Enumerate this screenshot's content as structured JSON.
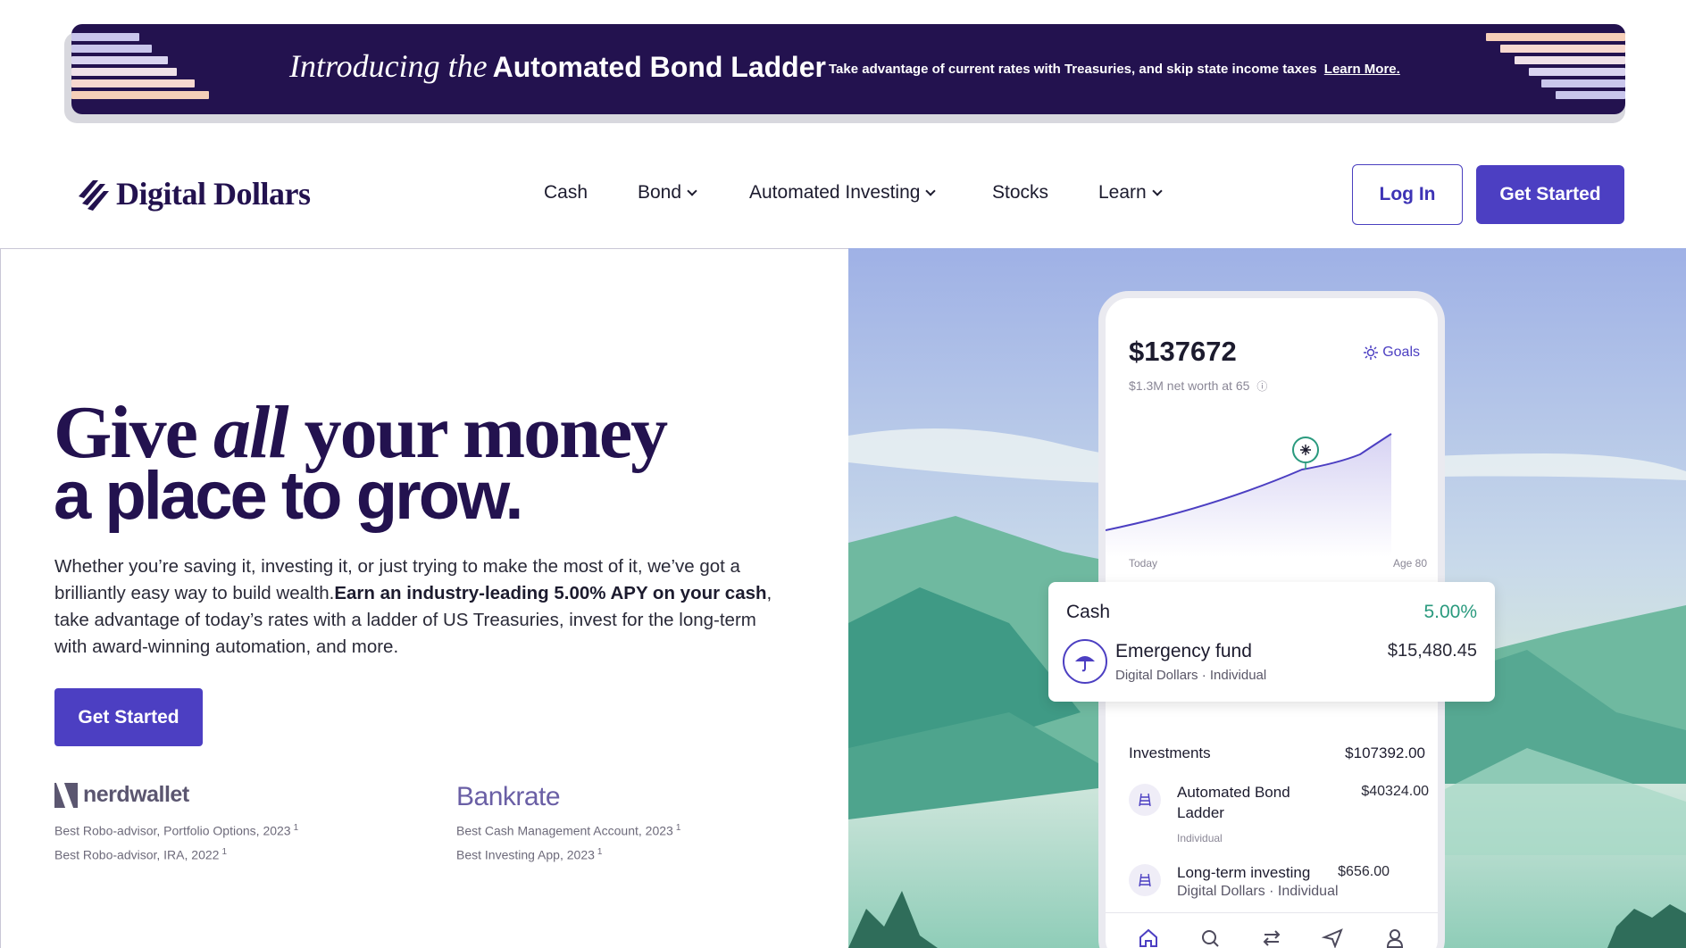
{
  "banner": {
    "title_italic": "Introducing the",
    "title_bold": "Automated Bond Ladder",
    "text": "Take advantage of current rates with Treasuries, and skip state income taxes",
    "link": "Learn More.",
    "bg_color": "#23124f"
  },
  "nav": {
    "logo": "Digital Dollars",
    "items": [
      {
        "label": "Cash",
        "has_dropdown": false
      },
      {
        "label": "Bond",
        "has_dropdown": true
      },
      {
        "label": "Automated Investing",
        "has_dropdown": true
      },
      {
        "label": "Stocks",
        "has_dropdown": false
      },
      {
        "label": "Learn",
        "has_dropdown": true
      }
    ],
    "login_label": "Log In",
    "get_started_label": "Get Started",
    "accent_color": "#4c3fc2"
  },
  "hero": {
    "line1_a": "Give",
    "line1_em": "all",
    "line1_b": "your money",
    "line2": "a place to grow.",
    "para_a": "Whether you’re saving it, investing it, or just trying to make the most of it, we’ve got a brilliantly easy way to build wealth.",
    "para_bold": "Earn an industry-leading 5.00% APY on your cash",
    "para_b": ", take advantage of today’s rates with a ladder of US Treasuries, invest for the long-term with award-winning automation, and more.",
    "cta_label": "Get Started"
  },
  "awards": {
    "nerdwallet": {
      "logo": "nerdwallet",
      "items": [
        "Best Robo-advisor, Portfolio Options, 2023",
        "Best Robo-advisor, IRA, 2022"
      ],
      "footnote": "1"
    },
    "bankrate": {
      "logo": "Bankrate",
      "items": [
        "Best Cash Management Account, 2023",
        "Best Investing App, 2023"
      ],
      "footnote": "1"
    }
  },
  "phone": {
    "balance": "$137672",
    "goals_label": "Goals",
    "net_worth_note": "$1.3M net worth at 65",
    "chart_start_label": "Today",
    "chart_end_label": "Age 80",
    "cash_card": {
      "label": "Cash",
      "rate": "5.00%",
      "name": "Emergency fund",
      "amount": "$15,480.45",
      "meta": "Digital Dollars · Individual"
    },
    "investments_label": "Investments",
    "investments_total": "$107392.00",
    "rows": [
      {
        "name_line1": "Automated Bond",
        "name_line2": "Ladder",
        "amount": "$40324.00",
        "meta": "Individual"
      },
      {
        "name_line1": "Long-term investing",
        "amount": "$656.00",
        "meta": "Digital Dollars · Individual"
      }
    ],
    "tab_icons": [
      "home-icon",
      "search-icon",
      "transfer-icon",
      "send-icon",
      "profile-icon"
    ]
  }
}
